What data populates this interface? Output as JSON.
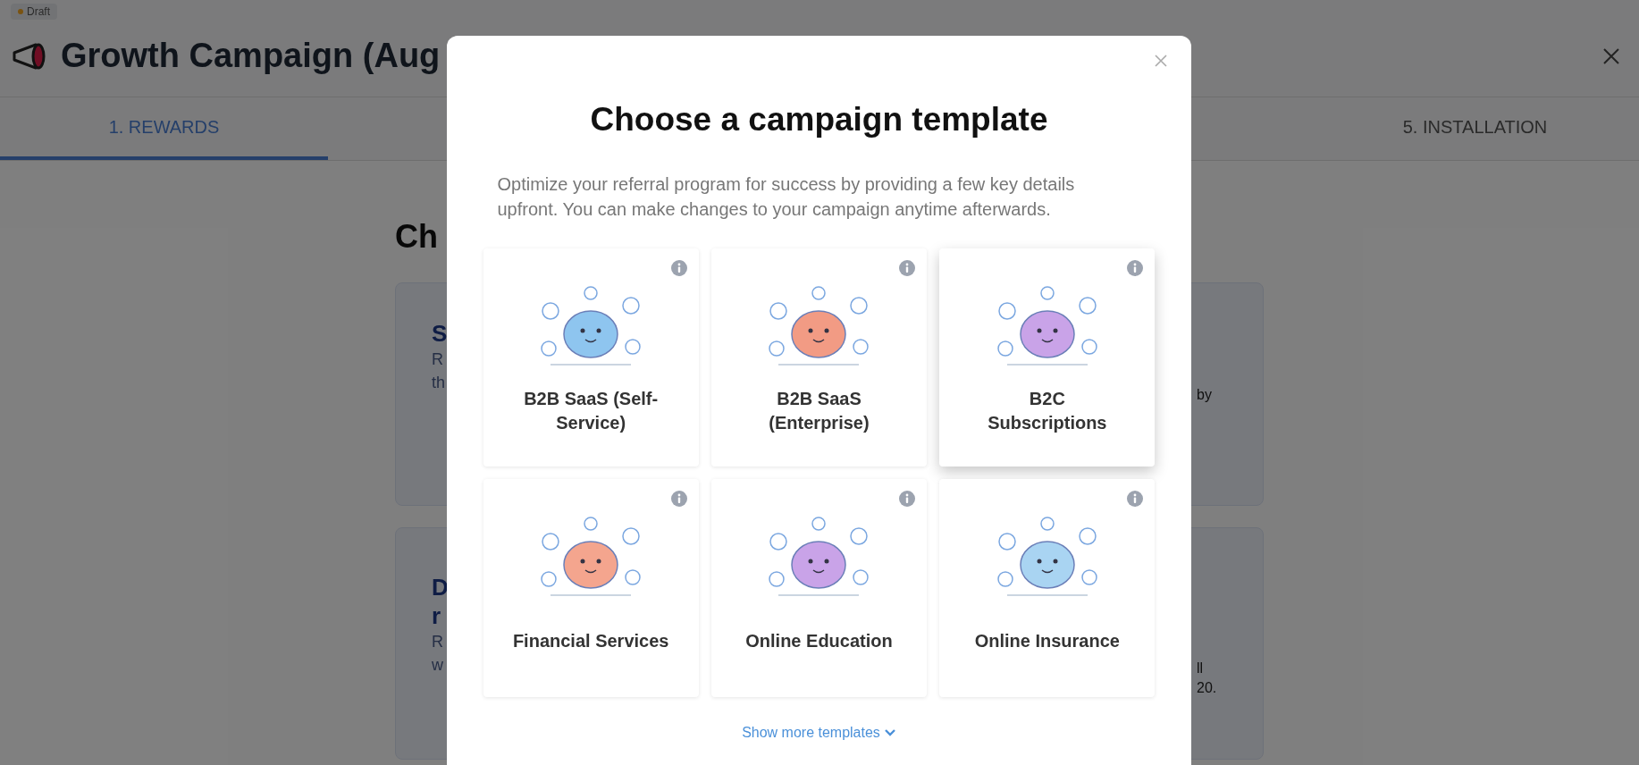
{
  "page": {
    "status_badge": "Draft",
    "title": "Growth Campaign (Aug",
    "tabs": [
      {
        "label": "1. REWARDS",
        "selected": true
      },
      {
        "label": "5. INSTALLATION",
        "selected": false
      }
    ],
    "section_heading": "Ch",
    "cards": [
      {
        "heading": [
          "S"
        ],
        "description": [
          "R",
          "th"
        ],
        "trailing": [
          "by"
        ]
      },
      {
        "heading": [
          "D",
          "r"
        ],
        "description": [
          "R",
          "w"
        ],
        "trailing": [
          "ll",
          "20."
        ]
      }
    ]
  },
  "modal": {
    "title": "Choose a campaign template",
    "description": "Optimize your referral program for success by providing a few key details upfront. You can make changes to your campaign anytime afterwards.",
    "templates": [
      {
        "name": "B2B SaaS (Self-Service)",
        "hovered": false
      },
      {
        "name": "B2B SaaS (Enterprise)",
        "hovered": false
      },
      {
        "name": "B2C Subscriptions",
        "hovered": true
      },
      {
        "name": "Financial Services",
        "hovered": false
      },
      {
        "name": "Online Education",
        "hovered": false
      },
      {
        "name": "Online Insurance",
        "hovered": false
      }
    ],
    "show_more": "Show more templates"
  }
}
